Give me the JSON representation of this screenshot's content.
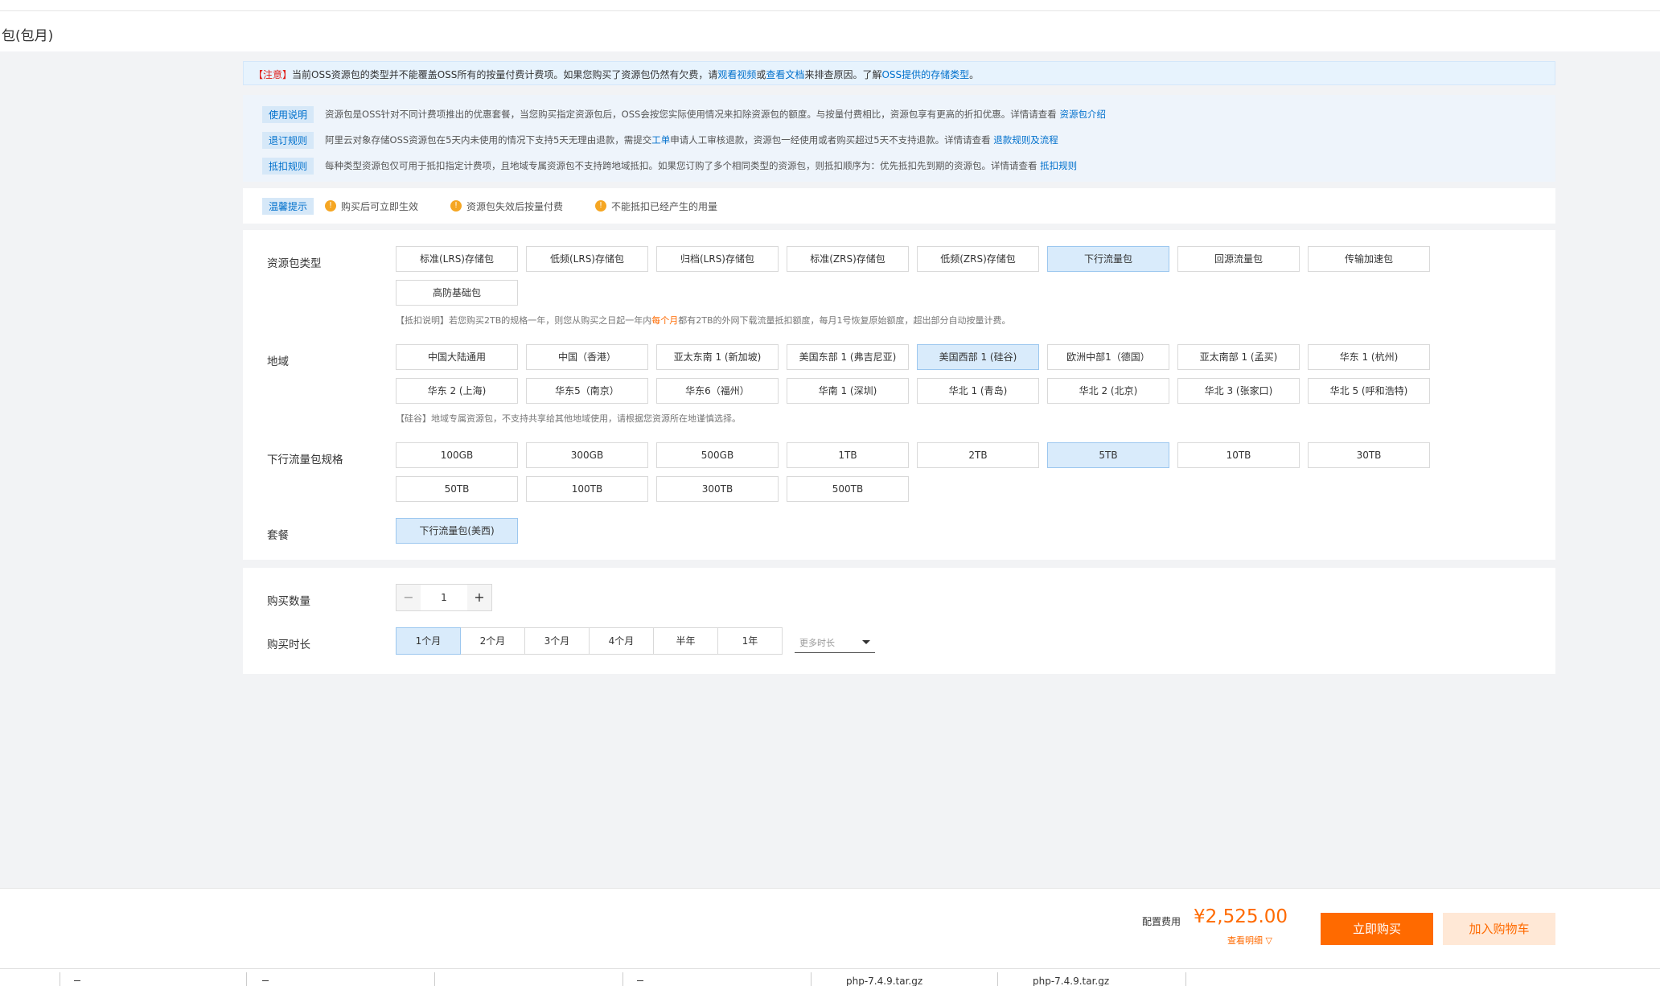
{
  "header": {
    "title": "包(包月)"
  },
  "notice": {
    "tag": "【注意】",
    "text1": "当前OSS资源包的类型并不能覆盖OSS所有的按量付费计费项。如果您购买了资源包仍然有欠费，请",
    "link1": "观看视频",
    "mid": "或",
    "link2": "查看文档",
    "text2": "来排查原因。了解",
    "link3": "OSS提供的存储类型",
    "end": "。"
  },
  "info": {
    "rows": [
      {
        "tag": "使用说明",
        "text": "资源包是OSS针对不同计费项推出的优惠套餐，当您购买指定资源包后，OSS会按您实际使用情况来扣除资源包的额度。与按量付费相比，资源包享有更高的折扣优惠。详情请查看 ",
        "link": "资源包介绍"
      },
      {
        "tag": "退订规则",
        "text": "阿里云对象存储OSS资源包在5天内未使用的情况下支持5天无理由退款，需提交",
        "link": "工单",
        "text2": "申请人工审核退款，资源包一经使用或者购买超过5天不支持退款。详情请查看 ",
        "link2": "退款规则及流程"
      },
      {
        "tag": "抵扣规则",
        "text": "每种类型资源包仅可用于抵扣指定计费项，且地域专属资源包不支持跨地域抵扣。如果您订购了多个相同类型的资源包，则抵扣顺序为：优先抵扣先到期的资源包。详情请查看 ",
        "link": "抵扣规则"
      }
    ]
  },
  "tips": {
    "tag": "温馨提示",
    "items": [
      "购买后可立即生效",
      "资源包失效后按量付费",
      "不能抵扣已经产生的用量"
    ]
  },
  "package_type": {
    "label": "资源包类型",
    "options": [
      "标准(LRS)存储包",
      "低频(LRS)存储包",
      "归档(LRS)存储包",
      "标准(ZRS)存储包",
      "低频(ZRS)存储包",
      "下行流量包",
      "回源流量包",
      "传输加速包",
      "高防基础包"
    ],
    "selected": "下行流量包",
    "hint_prefix": "【抵扣说明】若您购买2TB的规格一年，则您从购买之日起一年内",
    "hint_orange": "每个月",
    "hint_suffix": "都有2TB的外网下载流量抵扣额度，每月1号恢复原始额度，超出部分自动按量计费。"
  },
  "region": {
    "label": "地域",
    "options": [
      "中国大陆通用",
      "中国（香港）",
      "亚太东南 1 (新加坡)",
      "美国东部 1 (弗吉尼亚)",
      "美国西部 1 (硅谷)",
      "欧洲中部1（德国）",
      "亚太南部 1 (孟买)",
      "华东 1 (杭州)",
      "华东 2 (上海)",
      "华东5（南京）",
      "华东6（福州）",
      "华南 1 (深圳)",
      "华北 1 (青岛)",
      "华北 2 (北京)",
      "华北 3 (张家口)",
      "华北 5 (呼和浩特)"
    ],
    "selected": "美国西部 1 (硅谷)",
    "hint": "【硅谷】地域专属资源包，不支持共享给其他地域使用，请根据您资源所在地谨慎选择。"
  },
  "spec": {
    "label": "下行流量包规格",
    "options": [
      "100GB",
      "300GB",
      "500GB",
      "1TB",
      "2TB",
      "5TB",
      "10TB",
      "30TB",
      "50TB",
      "100TB",
      "300TB",
      "500TB"
    ],
    "selected": "5TB"
  },
  "plan": {
    "label": "套餐",
    "options": [
      "下行流量包(美西)"
    ],
    "selected": "下行流量包(美西)"
  },
  "quantity": {
    "label": "购买数量",
    "value": "1",
    "minus": "−",
    "plus": "+"
  },
  "duration": {
    "label": "购买时长",
    "options": [
      "1个月",
      "2个月",
      "3个月",
      "4个月",
      "半年",
      "1年"
    ],
    "selected": "1个月",
    "more_placeholder": "更多时长"
  },
  "footer": {
    "fee_label": "配置费用",
    "price": "¥2,525.00",
    "detail": "查看明细 ▽",
    "buy": "立即购买",
    "cart": "加入购物车"
  },
  "taskbar": {
    "files": [
      "php-7.4.9.tar.gz",
      "php-7.4.9.tar.gz"
    ]
  },
  "colors": {
    "accent": "#ff6a00",
    "link": "#0070cc",
    "selected_bg": "#d9ebfb"
  }
}
